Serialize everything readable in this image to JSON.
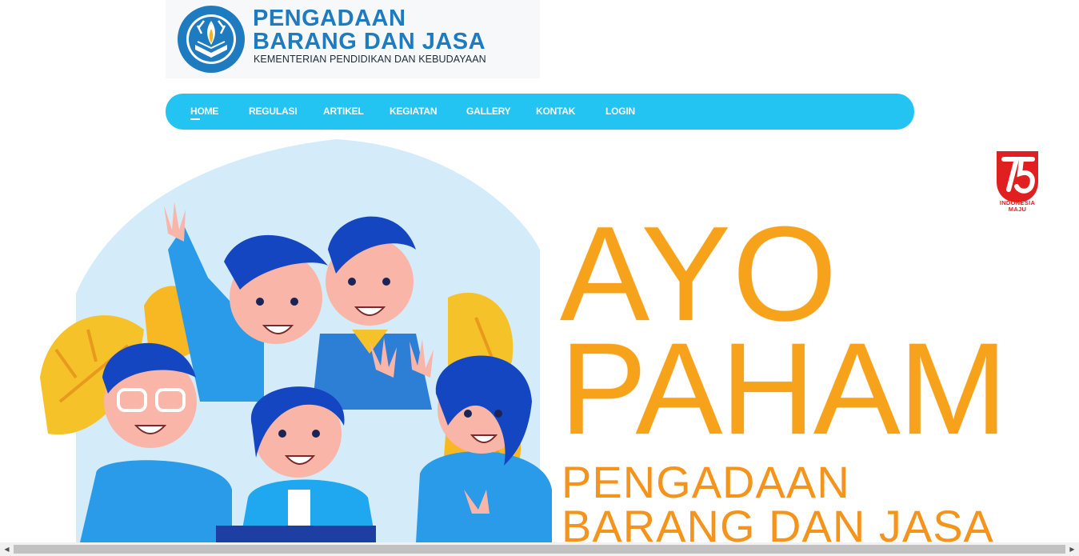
{
  "logo": {
    "emblem_text": "TUT WURI HANDAYANI",
    "title_line1": "PENGADAAN",
    "title_line2": "BARANG DAN JASA",
    "subtitle": "KEMENTERIAN PENDIDIKAN DAN KEBUDAYAAN"
  },
  "nav": {
    "items": [
      {
        "label": "HOME",
        "active": true
      },
      {
        "label": "REGULASI"
      },
      {
        "label": "ARTIKEL"
      },
      {
        "label": "KEGIATAN"
      },
      {
        "label": "GALLERY"
      },
      {
        "label": "KONTAK"
      },
      {
        "label": "LOGIN"
      }
    ]
  },
  "hero": {
    "line1": "AYO",
    "line2": "PAHAM",
    "line3": "PENGADAAN",
    "line4": "BARANG DAN JASA",
    "badge_number": "75",
    "badge_text_line1": "INDONESIA",
    "badge_text_line2": "MAJU"
  },
  "colors": {
    "brand_blue": "#1f7bbf",
    "nav_bg": "#23c3f2",
    "hero_orange": "#f7a21b",
    "badge_red": "#e02020"
  },
  "icons": {
    "scroll_left": "scroll-left-arrow-icon",
    "scroll_right": "scroll-right-arrow-icon"
  }
}
